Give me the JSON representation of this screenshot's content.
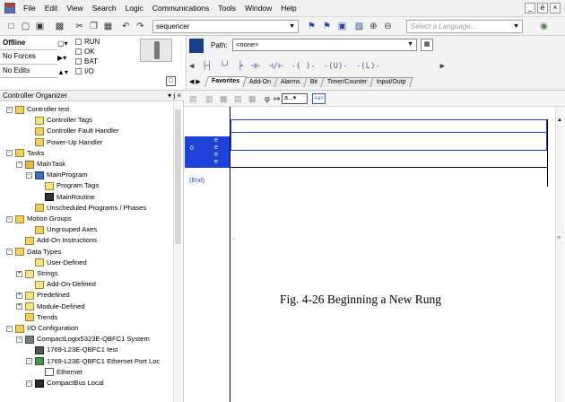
{
  "menubar": {
    "items": [
      "File",
      "Edit",
      "View",
      "Search",
      "Logic",
      "Communications",
      "Tools",
      "Window",
      "Help"
    ],
    "window_buttons": [
      "_",
      "ё",
      "×"
    ]
  },
  "toolbar": {
    "routine_value": "sequencer",
    "language_placeholder": "Select a Language...",
    "icons": [
      "new-icon",
      "open-icon",
      "save-icon",
      "print-icon",
      "cut-icon",
      "copy-icon",
      "paste-icon",
      "undo-icon",
      "redo-icon",
      "find-icon",
      "verify-icon",
      "zoom-in-icon",
      "zoom-out-icon"
    ]
  },
  "status": {
    "mode": "Offline",
    "forces": "No Forces",
    "edits": "No Edits",
    "indicators": [
      "RUN",
      "OK",
      "BAT",
      "I/O"
    ]
  },
  "instruction_bar": {
    "path_label": "Path:",
    "path_value": "<none>",
    "tabs": [
      "Favorites",
      "Add-On",
      "Alarms",
      "Bit",
      "Timer/Counter",
      "Input/Outp"
    ]
  },
  "organizer": {
    "title": "Controller Organizer",
    "header_buttons": "▾ ј ×",
    "nodes": [
      {
        "label": "Controller test",
        "icon": "folder-icon",
        "depth": 0,
        "expander": "-"
      },
      {
        "label": "Controller Tags",
        "icon": "tags-icon",
        "depth": 2,
        "expander": ""
      },
      {
        "label": "Controller Fault Handler",
        "icon": "folder-icon",
        "depth": 2,
        "expander": ""
      },
      {
        "label": "Power-Up Handler",
        "icon": "folder-icon",
        "depth": 2,
        "expander": ""
      },
      {
        "label": "Tasks",
        "icon": "folder-icon",
        "depth": 0,
        "expander": "-"
      },
      {
        "label": "MainTask",
        "icon": "task-icon",
        "depth": 1,
        "expander": "-"
      },
      {
        "label": "MainProgram",
        "icon": "program-icon",
        "depth": 2,
        "expander": "-"
      },
      {
        "label": "Program Tags",
        "icon": "tags-icon",
        "depth": 3,
        "expander": ""
      },
      {
        "label": "MainRoutine",
        "icon": "routine-icon",
        "depth": 3,
        "expander": ""
      },
      {
        "label": "Unscheduled Programs / Phases",
        "icon": "folder-icon",
        "depth": 2,
        "expander": ""
      },
      {
        "label": "Motion Groups",
        "icon": "folder-icon",
        "depth": 0,
        "expander": "-"
      },
      {
        "label": "Ungrouped Axes",
        "icon": "folder-icon",
        "depth": 2,
        "expander": ""
      },
      {
        "label": "Add-On Instructions",
        "icon": "folder-icon",
        "depth": 1,
        "expander": ""
      },
      {
        "label": "Data Types",
        "icon": "folder-icon",
        "depth": 0,
        "expander": "-"
      },
      {
        "label": "User-Defined",
        "icon": "tags-icon",
        "depth": 2,
        "expander": ""
      },
      {
        "label": "Strings",
        "icon": "tags-icon",
        "depth": 1,
        "expander": "+"
      },
      {
        "label": "Add-On-Defined",
        "icon": "tags-icon",
        "depth": 2,
        "expander": ""
      },
      {
        "label": "Predefined",
        "icon": "tags-icon",
        "depth": 1,
        "expander": "+"
      },
      {
        "label": "Module-Defined",
        "icon": "tags-icon",
        "depth": 1,
        "expander": "+"
      },
      {
        "label": "Trends",
        "icon": "folder-icon",
        "depth": 1,
        "expander": ""
      },
      {
        "label": "I/O Configuration",
        "icon": "folder-icon",
        "depth": 0,
        "expander": "-"
      },
      {
        "label": "CompactLogix5323E-QBFC1 System",
        "icon": "cpu-icon",
        "depth": 1,
        "expander": "-"
      },
      {
        "label": "1769-L23E-QBFC1 test",
        "icon": "module-icon",
        "depth": 2,
        "expander": ""
      },
      {
        "label": "1769-L23E-QBFC1 Ethernet Port Loc",
        "icon": "ethernet-port-icon",
        "depth": 2,
        "expander": "-"
      },
      {
        "label": "Ethernet",
        "icon": "network-icon",
        "depth": 3,
        "expander": ""
      },
      {
        "label": "CompactBus Local",
        "icon": "bus-icon",
        "depth": 2,
        "expander": "-"
      }
    ]
  },
  "ladder": {
    "zoom_value": "a...",
    "toolbar_button": "<a>",
    "rung_number": "0",
    "error_markers": [
      "e",
      "e",
      "e",
      "e"
    ],
    "end_label": "(End)",
    "caption": "Fig. 4-26  Beginning a New Rung"
  }
}
